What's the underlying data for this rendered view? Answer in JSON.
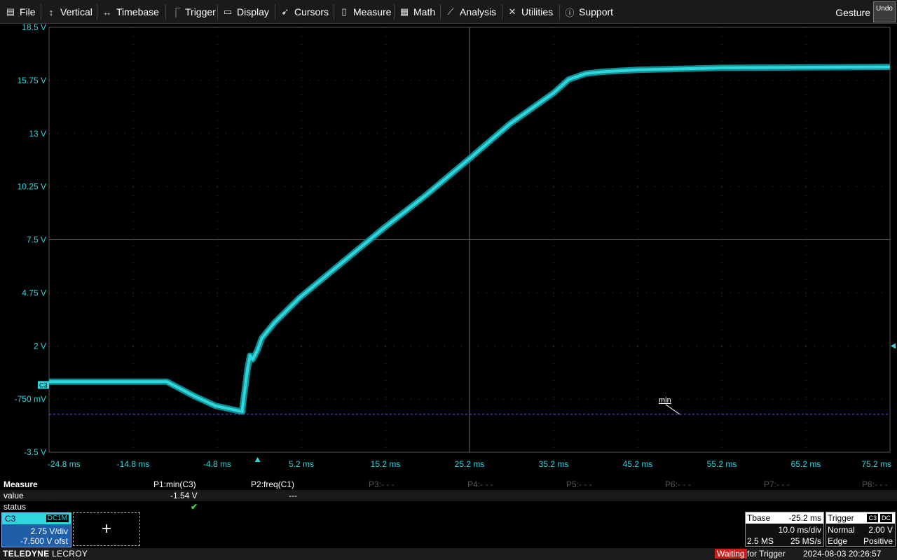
{
  "menu": {
    "items": [
      {
        "label": "File",
        "icon": "file-icon"
      },
      {
        "label": "Vertical",
        "icon": "vertical-arrows-icon"
      },
      {
        "label": "Timebase",
        "icon": "horizontal-arrows-icon"
      },
      {
        "label": "Trigger",
        "icon": "trigger-icon"
      },
      {
        "label": "Display",
        "icon": "display-icon"
      },
      {
        "label": "Cursors",
        "icon": "cursor-icon"
      },
      {
        "label": "Measure",
        "icon": "measure-icon"
      },
      {
        "label": "Math",
        "icon": "calculator-icon"
      },
      {
        "label": "Analysis",
        "icon": "analysis-chart-icon"
      },
      {
        "label": "Utilities",
        "icon": "wrench-icon"
      },
      {
        "label": "Support",
        "icon": "info-icon"
      }
    ],
    "gesture_label": "Gesture",
    "undo_label": "Undo"
  },
  "scope": {
    "y_labels": [
      "18.5 V",
      "15.75 V",
      "13 V",
      "10.25 V",
      "7.5 V",
      "4.75 V",
      "2 V",
      "-750 mV",
      "-3.5 V"
    ],
    "x_labels": [
      "-24.8 ms",
      "-14.8 ms",
      "-4.8 ms",
      "5.2 ms",
      "15.2 ms",
      "25.2 ms",
      "35.2 ms",
      "45.2 ms",
      "55.2 ms",
      "65.2 ms",
      "75.2 ms"
    ],
    "channel_marker": "C3",
    "min_marker_label": "min",
    "trace_color": "#2fd6dc"
  },
  "chart_data": {
    "type": "line",
    "x_unit": "ms",
    "y_unit": "V",
    "xlim": [
      -24.8,
      75.2
    ],
    "ylim": [
      -3.5,
      18.5
    ],
    "min_level": -1.54,
    "trigger_level": 2.0,
    "series": [
      {
        "name": "C3",
        "x": [
          -24.8,
          -10.8,
          -7.5,
          -5,
          -1.8,
          -1.8,
          -1.2,
          -0.9,
          -0.6,
          0,
          0.5,
          2,
          5,
          10,
          15,
          20,
          25.2,
          30,
          35.2,
          37,
          39,
          41,
          45.2,
          55.2,
          75.2
        ],
        "values": [
          0.15,
          0.15,
          -0.6,
          -1.1,
          -1.4,
          -1.2,
          0.8,
          1.5,
          1.3,
          1.8,
          2.4,
          3.2,
          4.5,
          6.3,
          8.1,
          9.8,
          11.7,
          13.5,
          15.1,
          15.8,
          16.1,
          16.2,
          16.3,
          16.4,
          16.45
        ]
      }
    ]
  },
  "measure": {
    "title": "Measure",
    "row_value_label": "value",
    "row_status_label": "status",
    "params": [
      {
        "name": "P1:min(C3)",
        "value": "-1.54 V",
        "status": "✔"
      },
      {
        "name": "P2:freq(C1)",
        "value": "---",
        "status": ""
      },
      {
        "name": "P3:- - -",
        "value": "",
        "status": ""
      },
      {
        "name": "P4:- - -",
        "value": "",
        "status": ""
      },
      {
        "name": "P5:- - -",
        "value": "",
        "status": ""
      },
      {
        "name": "P6:- - -",
        "value": "",
        "status": ""
      },
      {
        "name": "P7:- - -",
        "value": "",
        "status": ""
      },
      {
        "name": "P8:- - -",
        "value": "",
        "status": ""
      }
    ]
  },
  "channel": {
    "name": "C3",
    "coupling": "DC1M",
    "vdiv": "2.75 V/div",
    "offset": "-7.500 V ofst"
  },
  "add_button_label": "+",
  "timebase": {
    "title": "Tbase",
    "delay": "-25.2 ms",
    "tdiv": "10.0 ms/div",
    "samples": "2.5 MS",
    "rate": "25 MS/s"
  },
  "trigger": {
    "title": "Trigger",
    "source": "C3",
    "coupling": "DC",
    "mode": "Normal",
    "level": "2.00 V",
    "type": "Edge",
    "slope": "Positive"
  },
  "status": {
    "brand_bold": "TELEDYNE",
    "brand_light": "LECROY",
    "waiting": "Waiting",
    "for_trigger": "for Trigger",
    "datetime": "2024-08-03 20:26:57"
  }
}
